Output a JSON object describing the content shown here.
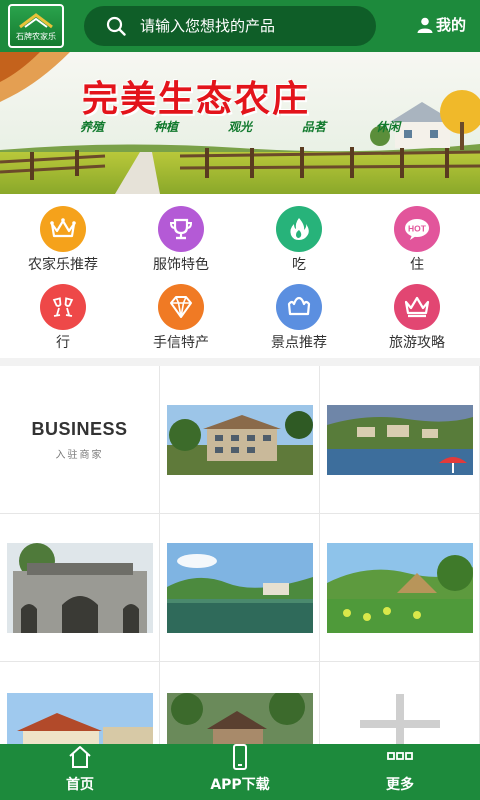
{
  "header": {
    "logo_text": "石牌农家乐",
    "search_placeholder": "请输入您想找的产品",
    "account_label": "我的"
  },
  "banner": {
    "title": "完美生态农庄",
    "tags": [
      "养殖",
      "种植",
      "观光",
      "品茗",
      "休闲"
    ]
  },
  "categories": [
    {
      "label": "农家乐推荐",
      "icon": "crown-icon",
      "color": "#f5a21b"
    },
    {
      "label": "服饰特色",
      "icon": "trophy-icon",
      "color": "#b45ad6"
    },
    {
      "label": "吃",
      "icon": "flame-icon",
      "color": "#27b37a"
    },
    {
      "label": "住",
      "icon": "hot-icon",
      "color": "#e2559b"
    },
    {
      "label": "行",
      "icon": "wine-glasses-icon",
      "color": "#ee4848"
    },
    {
      "label": "手信特产",
      "icon": "diamond-icon",
      "color": "#f07a24"
    },
    {
      "label": "景点推荐",
      "icon": "crown-icon",
      "color": "#5b8fe0"
    },
    {
      "label": "旅游攻略",
      "icon": "crown-icon",
      "color": "#e24672"
    }
  ],
  "business": {
    "title": "BUSINESS",
    "subtitle": "入驻商家"
  },
  "tabbar": [
    {
      "label": "首页",
      "icon": "home-icon"
    },
    {
      "label": "APP下载",
      "icon": "phone-icon"
    },
    {
      "label": "更多",
      "icon": "more-icon"
    }
  ],
  "colors": {
    "brand_green": "#1d8a3c",
    "search_bg": "#0f5e28",
    "banner_title": "#e3141b"
  }
}
